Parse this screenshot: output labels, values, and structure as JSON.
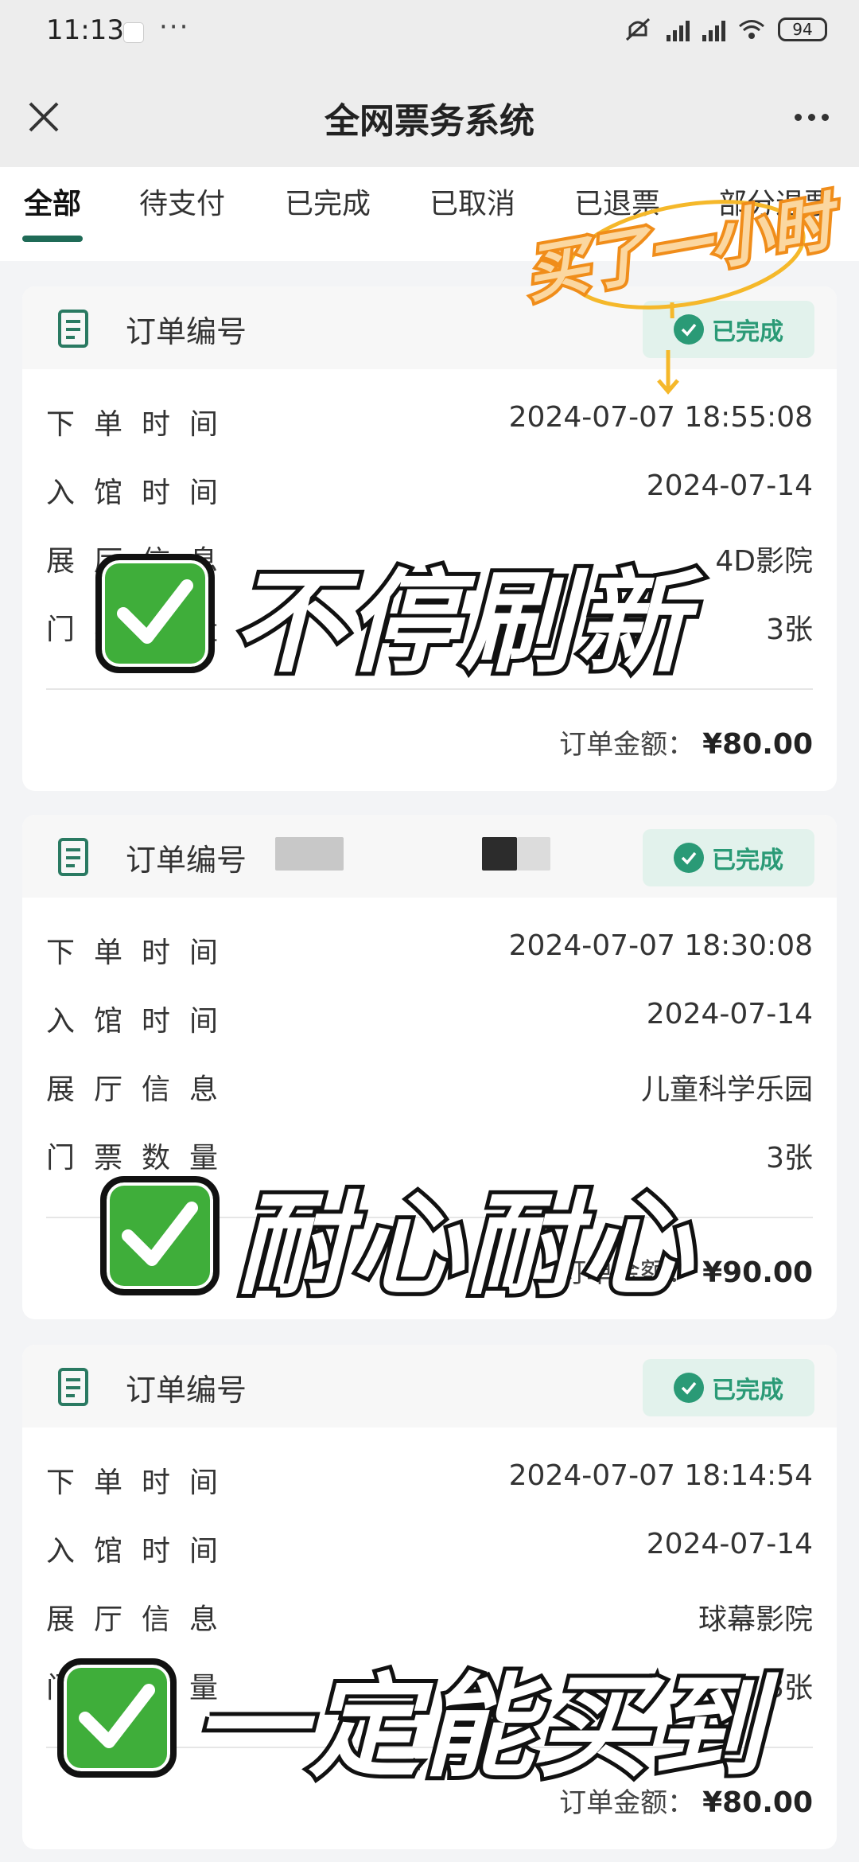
{
  "status_bar": {
    "time": "11:13",
    "dots": "···",
    "battery": "94"
  },
  "nav": {
    "title": "全网票务系统"
  },
  "tabs": [
    "全部",
    "待支付",
    "已完成",
    "已取消",
    "已退票",
    "部分退票"
  ],
  "labels": {
    "order_no": "订单编号",
    "order_time": "下单时间",
    "entry_time": "入馆时间",
    "hall_info": "展厅信息",
    "tickets": "门票数量",
    "amount_label": "订单金额："
  },
  "orders": [
    {
      "status": "已完成",
      "order_time": "2024-07-07 18:55:08",
      "entry_date": "2024-07-14",
      "hall": "4D影院",
      "tickets": "3张",
      "amount": "¥80.00"
    },
    {
      "status": "已完成",
      "order_time": "2024-07-07 18:30:08",
      "entry_date": "2024-07-14",
      "hall": "儿童科学乐园",
      "tickets": "3张",
      "amount": "¥90.00"
    },
    {
      "status": "已完成",
      "order_time": "2024-07-07 18:14:54",
      "entry_date": "2024-07-14",
      "hall": "球幕影院",
      "tickets": "3张",
      "amount": "¥80.00"
    }
  ],
  "overlays": {
    "sticker": "买了一小时",
    "line1": "不停刷新",
    "line2": "耐心耐心",
    "line3": "一定能买到"
  },
  "colors": {
    "accent": "#1f6b57",
    "badge_green": "#2a9a76",
    "badge_bg": "#e2f2ec",
    "sticker_orange": "#f08d1a"
  }
}
